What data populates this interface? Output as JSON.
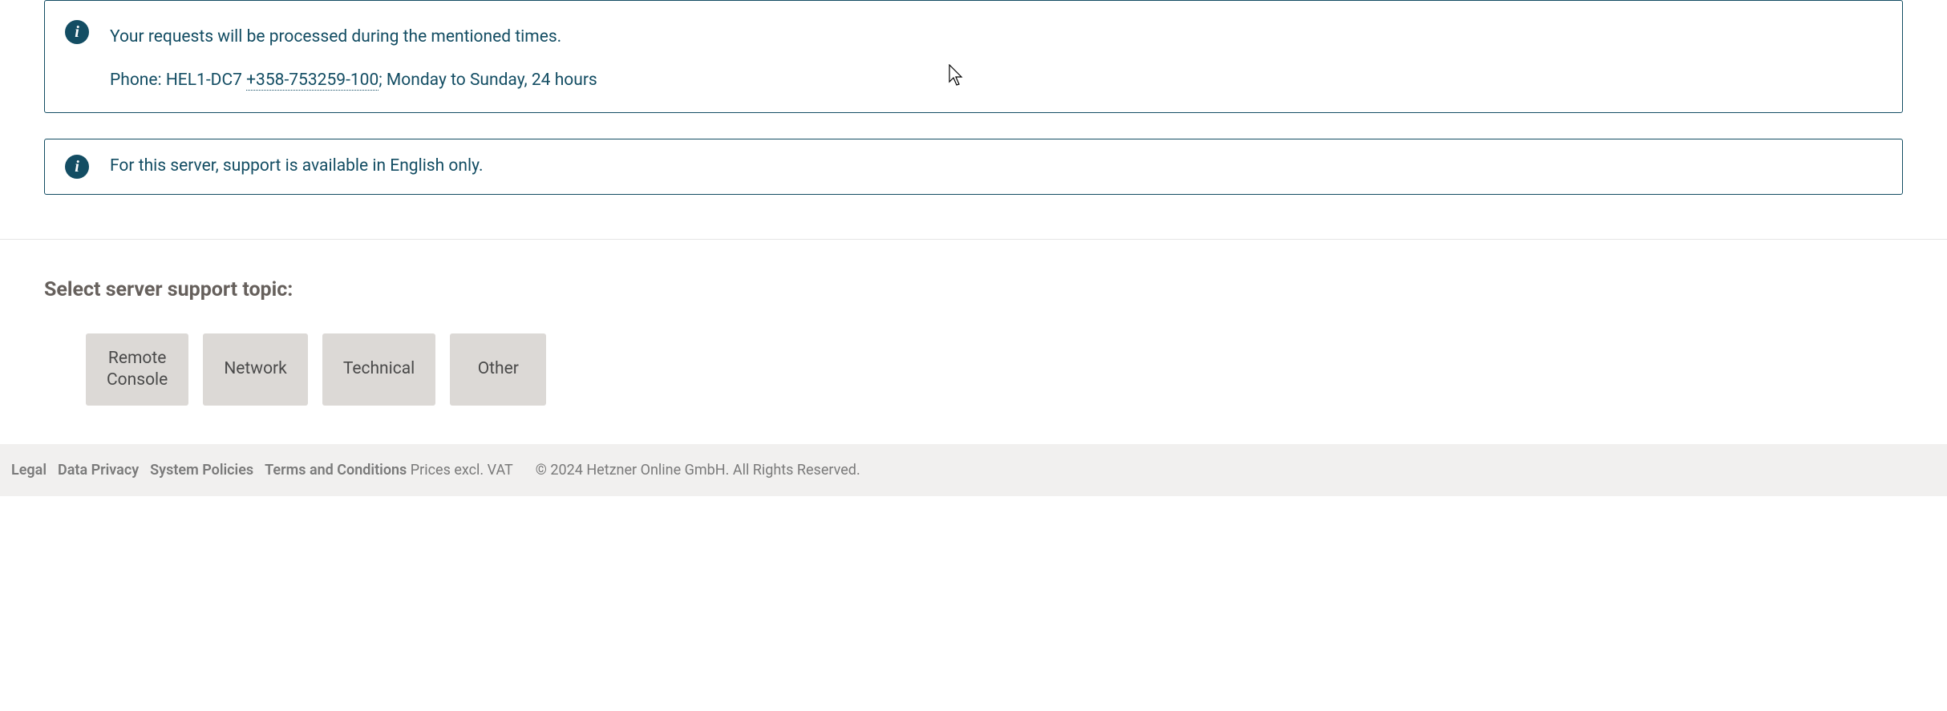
{
  "info_boxes": [
    {
      "line1": "Your requests will be processed during the mentioned times.",
      "phone_label": "Phone: ",
      "phone_location": "HEL1-DC7 ",
      "phone_number": "+358-753259-100",
      "phone_suffix": "; Monday to Sunday, 24 hours"
    },
    {
      "text": "For this server, support is available in English only."
    }
  ],
  "topic_section": {
    "heading": "Select server support topic:",
    "buttons": [
      {
        "label": "Remote\nConsole"
      },
      {
        "label": "Network"
      },
      {
        "label": "Technical"
      },
      {
        "label": "Other"
      }
    ]
  },
  "footer": {
    "links": [
      "Legal",
      "Data Privacy",
      "System Policies",
      "Terms and Conditions"
    ],
    "note": "Prices excl. VAT",
    "copyright": "© 2024 Hetzner Online GmbH. All Rights Reserved."
  }
}
